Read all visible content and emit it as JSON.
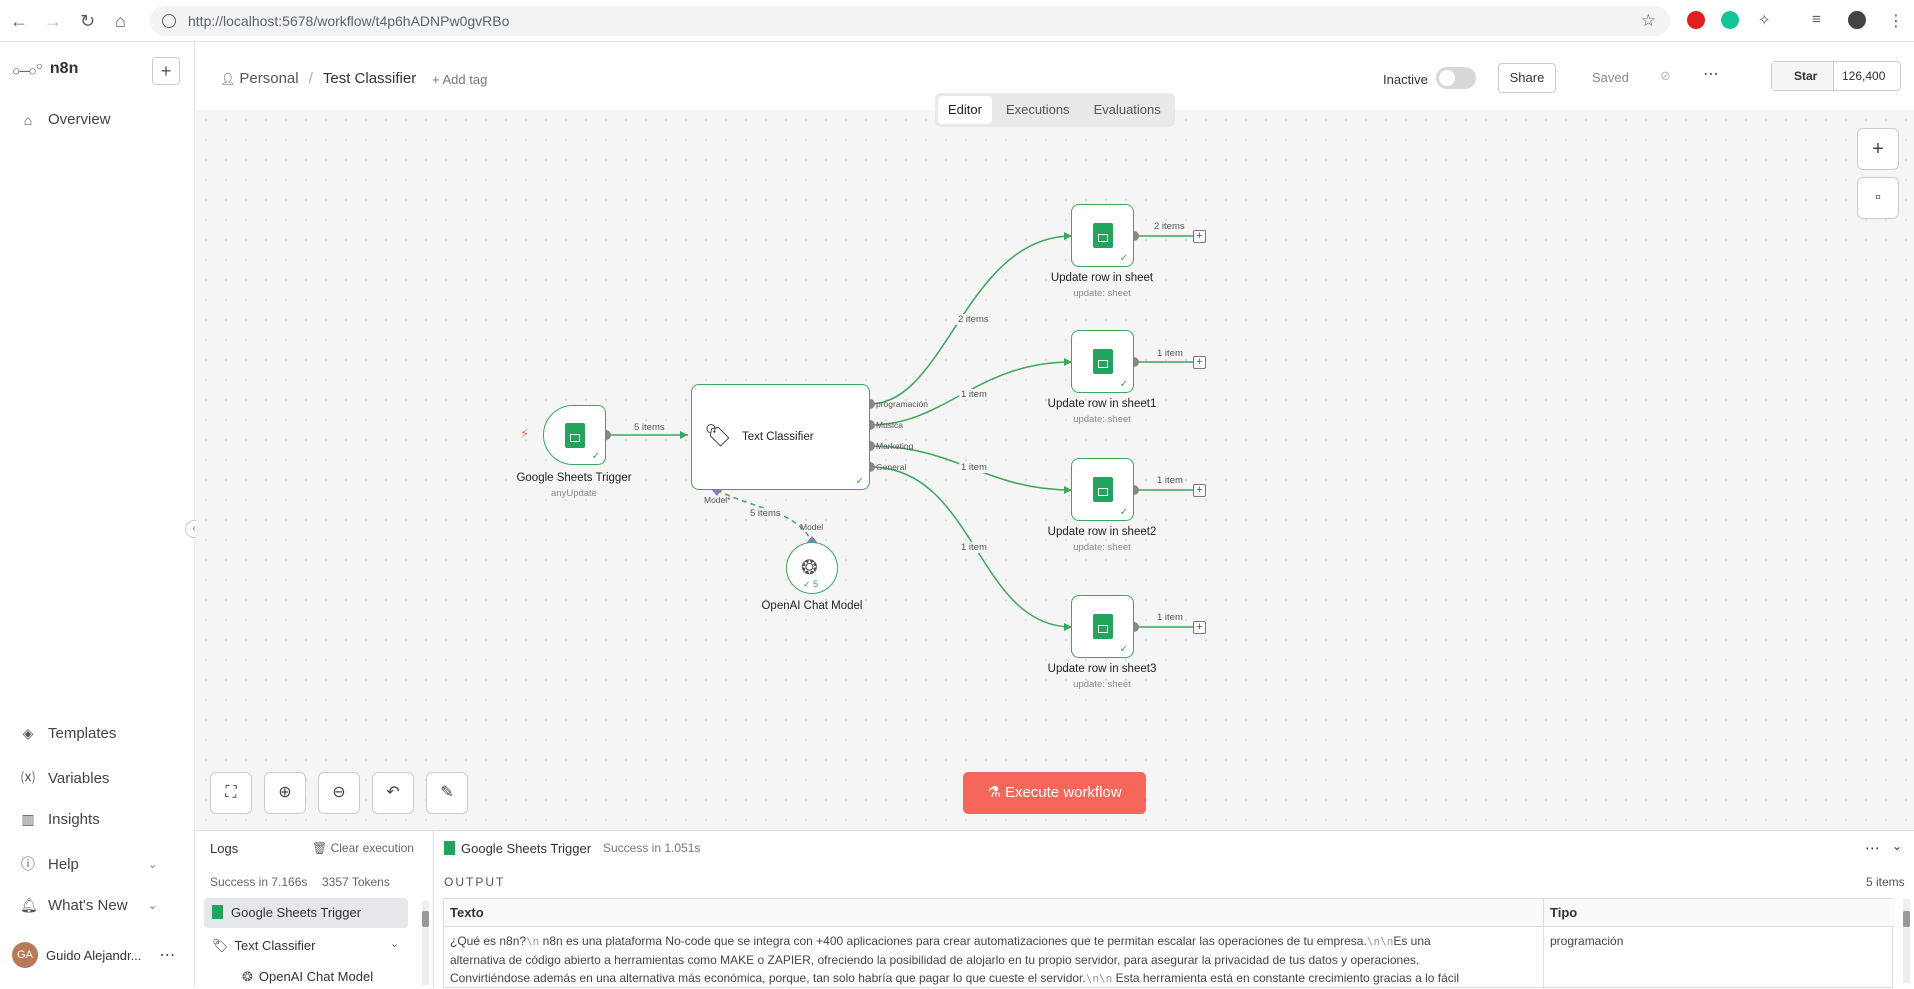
{
  "browser": {
    "url_host": "http://localhost",
    "url_rest": ":5678/workflow/t4p6hADNPw0gvRBo"
  },
  "sidebar": {
    "brand": "n8n",
    "items": [
      {
        "label": "Overview",
        "icon": "home-icon"
      },
      {
        "label": "Templates",
        "icon": "box-icon"
      },
      {
        "label": "Variables",
        "icon": "variable-icon"
      },
      {
        "label": "Insights",
        "icon": "chart-icon"
      },
      {
        "label": "Help",
        "icon": "help-icon"
      },
      {
        "label": "What's New",
        "icon": "bell-icon"
      }
    ],
    "user_initials": "GA",
    "user_name": "Guido Alejandr..."
  },
  "header": {
    "project": "Personal",
    "separator": "/",
    "workflow_name": "Test Classifier",
    "add_tag": "+ Add tag",
    "status_label": "Inactive",
    "share_label": "Share",
    "saved_label": "Saved",
    "github_star_label": "Star",
    "github_star_count": "126,400"
  },
  "tabs": [
    "Editor",
    "Executions",
    "Evaluations"
  ],
  "nodes": {
    "trigger": {
      "title": "Google Sheets Trigger",
      "subtitle": "anyUpdate"
    },
    "classifier": {
      "title": "Text Classifier",
      "ports": [
        "programación",
        "Musica",
        "Marketing",
        "General"
      ],
      "model_port": "Model*"
    },
    "openai": {
      "title": "OpenAI Chat Model",
      "count": "5",
      "port_label": "Model"
    },
    "sheets": [
      {
        "title": "Update row in sheet",
        "subtitle": "update: sheet",
        "out_label": "2 items"
      },
      {
        "title": "Update row in sheet1",
        "subtitle": "update: sheet",
        "out_label": "1 item"
      },
      {
        "title": "Update row in sheet2",
        "subtitle": "update: sheet",
        "out_label": "1 item"
      },
      {
        "title": "Update row in sheet3",
        "subtitle": "update: sheet",
        "out_label": "1 item"
      }
    ]
  },
  "edges": {
    "trigger_to_classifier": "5 items",
    "to_sheet0": "2 items",
    "to_sheet1": "1 item",
    "to_sheet2": "1 item",
    "to_sheet3": "1 item",
    "model_link": "5 items"
  },
  "execute_button": "Execute workflow",
  "logs": {
    "title": "Logs",
    "clear_label": "Clear execution",
    "summary_status": "Success in 7.166s",
    "summary_tokens": "3357 Tokens",
    "tree": [
      "Google Sheets Trigger",
      "Text Classifier",
      "OpenAI Chat Model"
    ],
    "selected_node": "Google Sheets Trigger",
    "selected_status": "Success in 1.051s",
    "output_label": "OUTPUT",
    "items_count": "5 items",
    "columns": [
      "Texto",
      "Tipo"
    ],
    "row_text_1a": "¿Qué es n8n?",
    "row_esc": "\\n",
    "row_text_1b": "n8n es una plataforma No-code que se integra con +400 aplicaciones para crear automatizaciones que te permitan escalar las operaciones de tu empresa.",
    "row_text_1c": "Es una",
    "row_text_2": "alternativa de código abierto a herramientas como MAKE o ZAPIER, ofreciendo la posibilidad de alojarlo en tu propio servidor, para asegurar la privacidad de tus datos y operaciones.",
    "row_text_3a": "Convirtiéndose además en una alternativa más económica, porque, tan solo habría que pagar lo que cueste el servidor.",
    "row_text_3b": "Esta herramienta está en constante crecimiento gracias a lo fácil",
    "row_tipo": "programación"
  },
  "colors": {
    "accent": "#f4675a",
    "success": "#3ea55d",
    "sheets_green": "#22a45d"
  }
}
